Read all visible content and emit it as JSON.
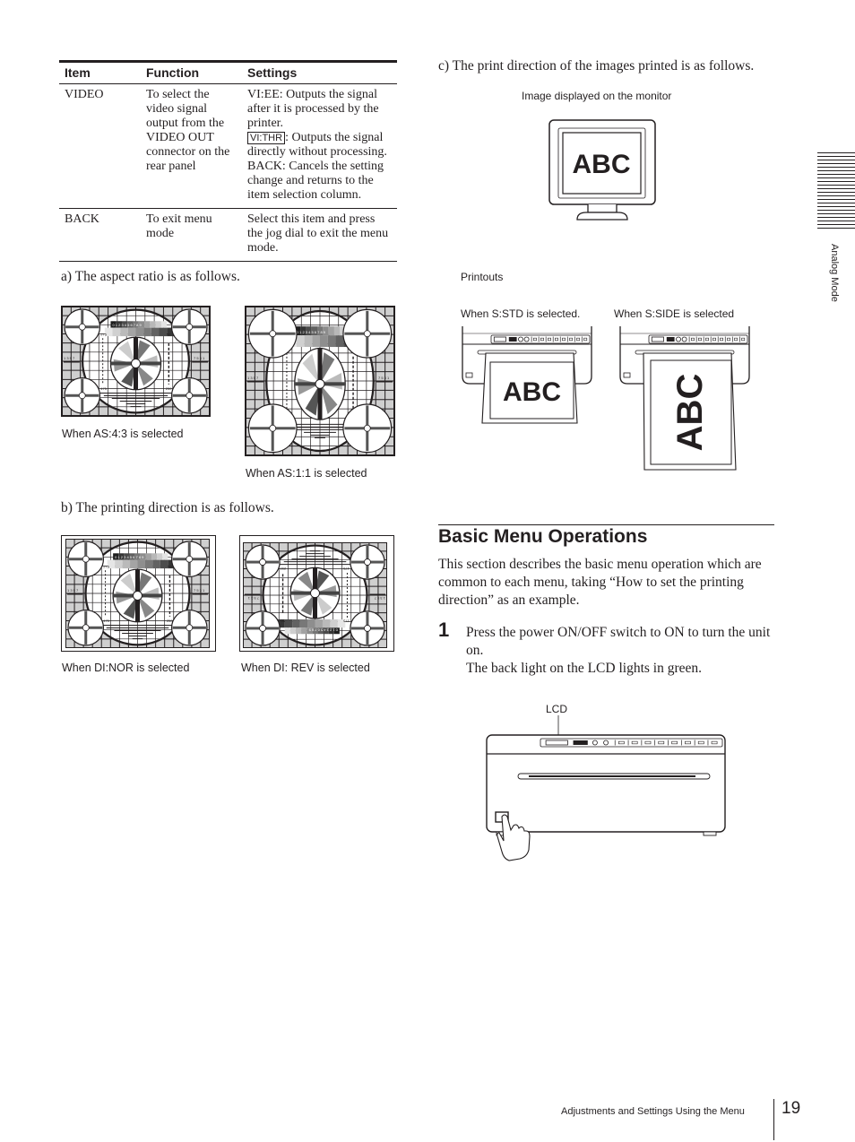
{
  "table": {
    "headers": [
      "Item",
      "Function",
      "Settings"
    ],
    "rows": [
      {
        "item": "VIDEO",
        "function": "To select the video signal output from the VIDEO OUT connector on the rear panel",
        "settings_parts": {
          "p1": "VI:EE: Outputs the signal after it is processed by the printer.",
          "boxed": "VI:THR",
          "p2": ": Outputs the signal directly without processing.",
          "p3": "BACK: Cancels the setting change and returns to the item selection column."
        }
      },
      {
        "item": "BACK",
        "function": "To exit menu mode",
        "settings": "Select this item and press the jog dial to exit the menu mode."
      }
    ]
  },
  "section_a": {
    "heading": "a) The aspect ratio is as follows.",
    "captions": [
      "When AS:4:3 is selected",
      "When AS:1:1 is selected"
    ]
  },
  "section_b": {
    "heading": "b) The printing direction is as follows.",
    "captions": [
      "When DI:NOR is selected",
      "When DI: REV is selected"
    ]
  },
  "section_c": {
    "heading": "c) The print direction of the images printed is as follows.",
    "monitor_caption": "Image displayed on the monitor",
    "monitor_text": "ABC",
    "printouts_label": "Printouts",
    "printout_captions": [
      "When S:STD is selected.",
      "When S:SIDE is selected"
    ],
    "printout_text": "ABC"
  },
  "test_pattern": {
    "gray_numbers": "0 1 2 3 4 5 6 7 8 9",
    "left_top": "275",
    "left_bottom": "475",
    "right_top": "50",
    "right_bottom": "250",
    "side_numbers_left": "1 3 5 7",
    "side_numbers_right": "7 5 3 1"
  },
  "basic_menu": {
    "title": "Basic Menu Operations",
    "intro": "This section describes the basic menu operation which are common to each menu, taking “How to set the printing direction” as an example.",
    "step_number": "1",
    "step_line1": "Press the power ON/OFF switch to ON to turn the unit on.",
    "step_line2": "The back light on the LCD lights in green.",
    "lcd_label": "LCD"
  },
  "side_tab": {
    "label": "Analog Mode"
  },
  "footer": {
    "section_title": "Adjustments and Settings Using the Menu",
    "page_number": "19"
  }
}
